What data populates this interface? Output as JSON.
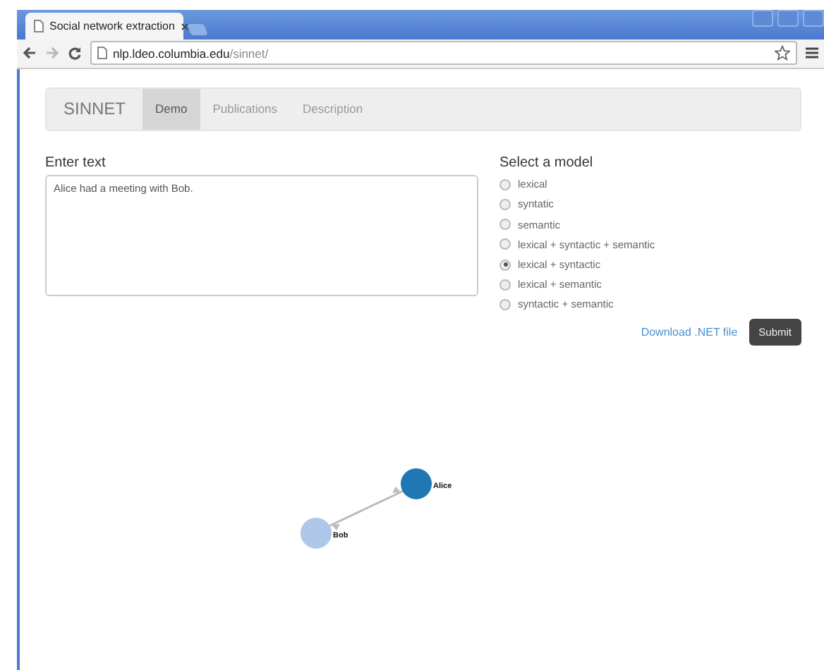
{
  "browser": {
    "tab_title": "Social network extraction",
    "address_host": "nlp.ldeo.columbia.edu",
    "address_path": "/sinnet/"
  },
  "navbar": {
    "brand": "SINNET",
    "items": [
      {
        "label": "Demo",
        "selected": true
      },
      {
        "label": "Publications",
        "selected": false
      },
      {
        "label": "Description",
        "selected": false
      }
    ]
  },
  "input": {
    "heading": "Enter text",
    "value": "Alice had a meeting with Bob."
  },
  "models": {
    "heading": "Select a model",
    "options": [
      {
        "label": "lexical",
        "selected": false
      },
      {
        "label": "syntatic",
        "selected": false
      },
      {
        "label": "semantic",
        "selected": false
      },
      {
        "label": "lexical + syntactic + semantic",
        "selected": false
      },
      {
        "label": "lexical + syntactic",
        "selected": true
      },
      {
        "label": "lexical + semantic",
        "selected": false
      },
      {
        "label": "syntactic + semantic",
        "selected": false
      }
    ]
  },
  "download_link": "Download .NET file",
  "submit": "Submit",
  "graph": {
    "nodes": [
      {
        "label": "Alice",
        "color": "#1f77b4"
      },
      {
        "label": "Bob",
        "color": "#aec7e8"
      }
    ]
  }
}
